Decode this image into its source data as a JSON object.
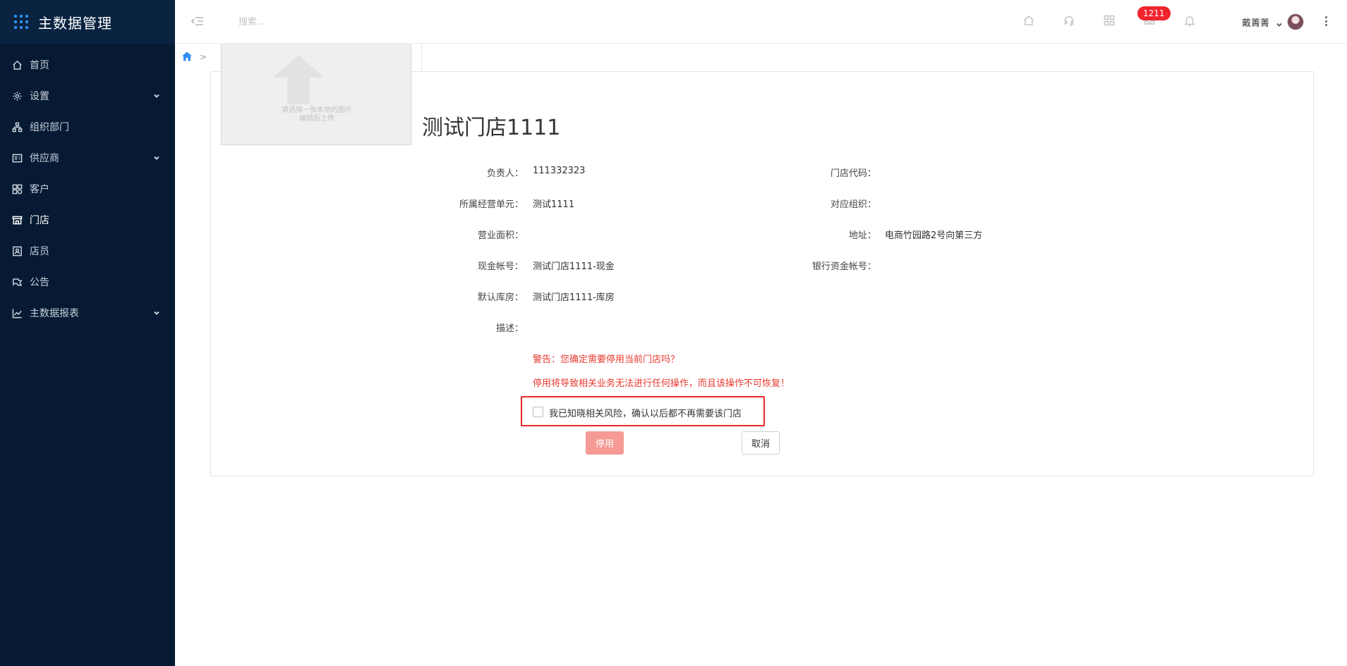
{
  "app": {
    "title": "主数据管理"
  },
  "sidebar": {
    "items": [
      {
        "label": "首页",
        "icon": "home-icon",
        "expandable": false
      },
      {
        "label": "设置",
        "icon": "gear-icon",
        "expandable": true
      },
      {
        "label": "组织部门",
        "icon": "org-chart-icon",
        "expandable": false
      },
      {
        "label": "供应商",
        "icon": "supplier-icon",
        "expandable": true
      },
      {
        "label": "客户",
        "icon": "customer-icon",
        "expandable": false
      },
      {
        "label": "门店",
        "icon": "store-icon",
        "expandable": false,
        "active": true
      },
      {
        "label": "店员",
        "icon": "staff-icon",
        "expandable": false
      },
      {
        "label": "公告",
        "icon": "announcement-icon",
        "expandable": false
      },
      {
        "label": "主数据报表",
        "icon": "chart-icon",
        "expandable": true
      }
    ]
  },
  "header": {
    "search_placeholder": "搜索...",
    "badge_count": "1211",
    "user_name": "戴菁菁",
    "icons": [
      "home-icon",
      "headset-icon",
      "apps-grid-icon",
      "message-icon",
      "bell-icon",
      "more-vertical-icon"
    ]
  },
  "breadcrumb": {
    "separator": ">"
  },
  "upload": {
    "line1": "请选择一张本地的图片",
    "line2": "编辑后上传"
  },
  "store": {
    "name": "测试门店1111",
    "fields": {
      "manager_label": "负责人：",
      "manager_value": "111332323",
      "code_label": "门店代码：",
      "code_value": "",
      "unit_label": "所属经营单元：",
      "unit_value": "测试1111",
      "org_label": "对应组织：",
      "org_value": "",
      "area_label": "营业面积：",
      "area_value": "",
      "address_label": "地址：",
      "address_value": "电商竹园路2号向第三方",
      "cash_label": "现金帐号：",
      "cash_value": "测试门店1111-现金",
      "bank_label": "银行资金帐号：",
      "bank_value": "",
      "warehouse_label": "默认库房：",
      "warehouse_value": "测试门店1111-库房",
      "desc_label": "描述：",
      "desc_value": ""
    }
  },
  "warning": {
    "line1": "警告：您确定需要停用当前门店吗？",
    "line2": "停用将导致相关业务无法进行任何操作，而且该操作不可恢复！"
  },
  "confirm": {
    "label": "我已知晓相关风险，确认以后都不再需要该门店",
    "checked": false
  },
  "actions": {
    "disable_label": "停用",
    "cancel_label": "取消"
  },
  "colors": {
    "sidebar_bg": "#061a33",
    "accent": "#2e8ff0",
    "danger": "#e8382f",
    "badge": "#f0242c",
    "disable_button": "#f59a95"
  }
}
